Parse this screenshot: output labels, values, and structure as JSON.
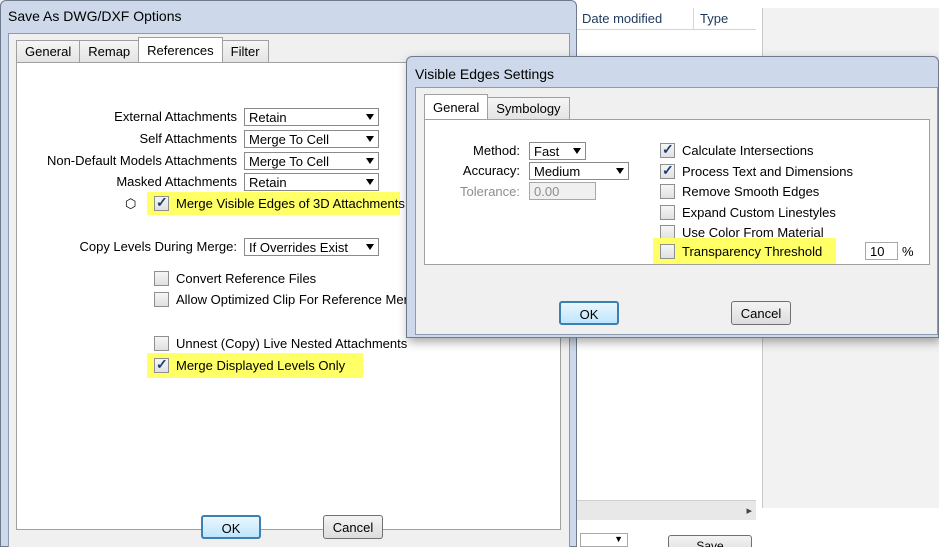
{
  "background_window": {
    "columns": [
      "Date modified",
      "Type"
    ],
    "save_label": "Save"
  },
  "main_dialog": {
    "title": "Save As DWG/DXF Options",
    "tabs": [
      {
        "label": "General",
        "active": false
      },
      {
        "label": "Remap",
        "active": false
      },
      {
        "label": "References",
        "active": true
      },
      {
        "label": "Filter",
        "active": false
      }
    ],
    "attachments": [
      {
        "label": "External Attachments",
        "value": "Retain"
      },
      {
        "label": "Self Attachments",
        "value": "Merge To Cell"
      },
      {
        "label": "Non-Default Models Attachments",
        "value": "Merge To Cell"
      },
      {
        "label": "Masked Attachments",
        "value": "Retain"
      }
    ],
    "merge_visible_edges": {
      "label": "Merge Visible Edges of 3D Attachments",
      "checked": true
    },
    "copy_levels": {
      "label": "Copy Levels During Merge:",
      "value": "If Overrides Exist"
    },
    "convert_reference_files": {
      "label": "Convert Reference Files",
      "checked": false
    },
    "allow_optimized_clip": {
      "label": "Allow Optimized Clip For Reference Merge",
      "checked": false
    },
    "unnest_live_nested": {
      "label": "Unnest (Copy) Live Nested Attachments",
      "checked": false
    },
    "merge_displayed_levels": {
      "label": "Merge Displayed Levels Only",
      "checked": true
    },
    "ok_label": "OK",
    "cancel_label": "Cancel",
    "highlight_color": "#ffff66"
  },
  "visible_edges_dialog": {
    "title": "Visible Edges Settings",
    "tabs": [
      {
        "label": "General",
        "active": true
      },
      {
        "label": "Symbology",
        "active": false
      }
    ],
    "method": {
      "label": "Method:",
      "value": "Fast"
    },
    "accuracy": {
      "label": "Accuracy:",
      "value": "Medium"
    },
    "tolerance": {
      "label": "Tolerance:",
      "value": "0.00"
    },
    "options": [
      {
        "label": "Calculate Intersections",
        "checked": true
      },
      {
        "label": "Process Text and Dimensions",
        "checked": true
      },
      {
        "label": "Remove Smooth Edges",
        "checked": false
      },
      {
        "label": "Expand Custom Linestyles",
        "checked": false
      },
      {
        "label": "Use Color From Material",
        "checked": false
      },
      {
        "label": "Transparency Threshold",
        "checked": false
      }
    ],
    "threshold_value": "10",
    "threshold_unit": "%",
    "ok_label": "OK",
    "cancel_label": "Cancel"
  }
}
